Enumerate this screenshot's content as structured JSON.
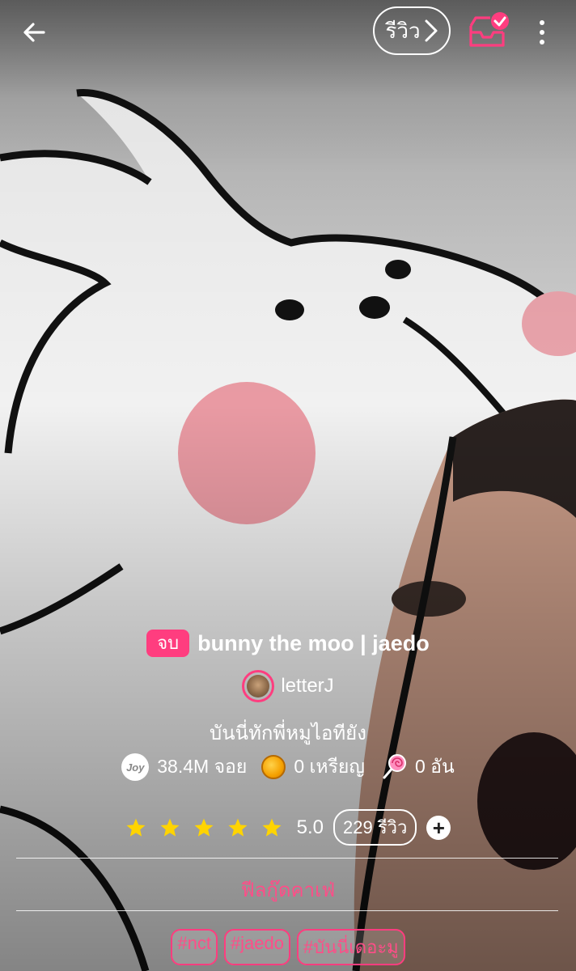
{
  "topbar": {
    "back_icon": "arrow-left-icon",
    "review_label": "รีวิว",
    "inbox_icon": "inbox-check-icon",
    "more_icon": "more-vertical-icon"
  },
  "story": {
    "status_badge": "จบ",
    "title": "bunny the moo | jaedo",
    "author": "letterJ",
    "tagline": "บันนี่ทักพี่หมูไอทียัง"
  },
  "stats": {
    "joy_icon_text": "Joy",
    "joys": "38.4M จอย",
    "coins": "0 เหรียญ",
    "candies": "0 อัน"
  },
  "rating": {
    "stars": 5,
    "value": "5.0",
    "reviews": "229 รีวิว",
    "add_label": "+"
  },
  "category": "ฟีลกู๊ดคาเฟ่",
  "tags": [
    "#nct",
    "#jaedo",
    "#บันนี่เดอะมู"
  ],
  "colors": {
    "accent": "#ff3d7f",
    "star": "#ffd400",
    "text": "#ffffff"
  }
}
